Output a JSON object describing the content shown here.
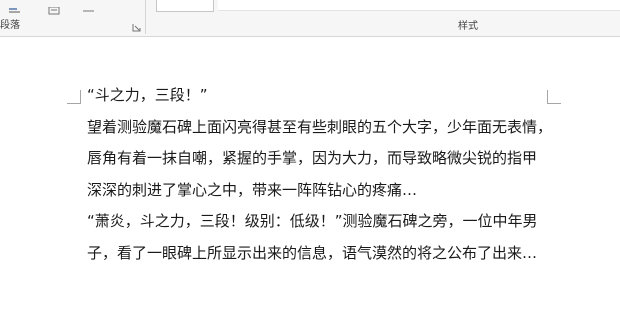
{
  "ribbon": {
    "paragraph_group_label": "段落",
    "styles_group_label": "样式",
    "icons": [
      "align-icon",
      "line-spacing-icon",
      "paragraph-icon",
      "dialog-launcher-icon"
    ]
  },
  "document": {
    "lines": [
      "“斗之力，三段！”",
      "望着测验魔石碑上面闪亮得甚至有些刺眼的五个大字，少年面无表情，",
      "唇角有着一抹自嘲，紧握的手掌，因为大力，而导致略微尖锐的指甲",
      "深深的刺进了掌心之中，带来一阵阵钻心的疼痛…",
      "“萧炎，斗之力，三段！级别：低级！”测验魔石碑之旁，一位中年男",
      "子，看了一眼碑上所显示出来的信息，语气漠然的将之公布了出来…"
    ]
  }
}
